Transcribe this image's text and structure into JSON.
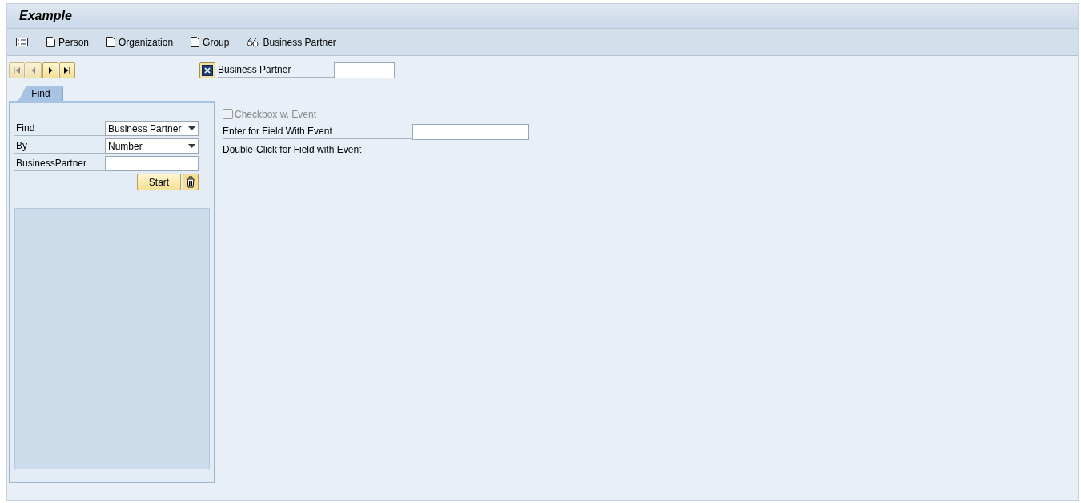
{
  "window": {
    "title": "Example"
  },
  "toolbar": [
    {
      "kind": "list"
    },
    {
      "kind": "doc",
      "label": "Person"
    },
    {
      "kind": "doc",
      "label": "Organization"
    },
    {
      "kind": "doc",
      "label": "Group"
    },
    {
      "kind": "glasses",
      "label": "Business Partner"
    }
  ],
  "navigation": [
    {
      "kind": "first",
      "disabled": true
    },
    {
      "kind": "previous",
      "disabled": true
    },
    {
      "kind": "next",
      "disabled": false
    },
    {
      "kind": "last",
      "disabled": false
    }
  ],
  "tabs": [
    {
      "label": "Find",
      "selected": true
    }
  ],
  "find_form": {
    "rows": [
      {
        "kind": "dropdown",
        "label": "Find",
        "value": "Business Partner"
      },
      {
        "kind": "dropdown",
        "label": "By",
        "value": "Number"
      },
      {
        "kind": "input",
        "label": "BusinessPartner"
      }
    ],
    "start_button": "Start"
  },
  "header_field": {
    "label": "Business Partner"
  },
  "checkbox": {
    "label": "Checkbox w. Event",
    "checked": false,
    "disabled": true
  },
  "event_field": {
    "label": "Enter for Field With Event"
  },
  "event_link": "Double-Click for Field with Event"
}
